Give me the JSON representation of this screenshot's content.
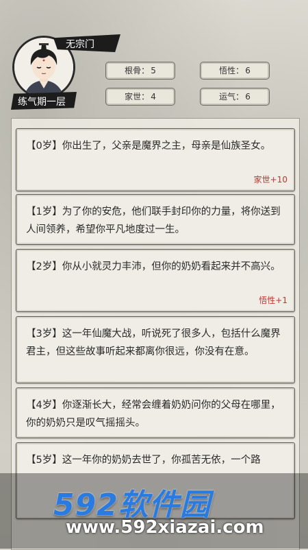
{
  "header": {
    "sect_name": "无宗门",
    "realm": "练气期一层"
  },
  "stats": [
    {
      "label": "根骨",
      "value": "5"
    },
    {
      "label": "悟性",
      "value": "6"
    },
    {
      "label": "家世",
      "value": "4"
    },
    {
      "label": "运气",
      "value": "6"
    }
  ],
  "events": [
    {
      "text": "【0岁】你出生了，父亲是魔界之主，母亲是仙族圣女。",
      "bonus": "家世+10"
    },
    {
      "text": "【1岁】为了你的安危，他们联手封印你的力量，将你送到人间领养，希望你平凡地度过一生。",
      "bonus": ""
    },
    {
      "text": "【2岁】你从小就灵力丰沛，但你的奶奶看起来并不高兴。",
      "bonus": "悟性+1"
    },
    {
      "text": "【3岁】这一年仙魔大战，听说死了很多人，包括什么魔界君主，但这些故事听起来都离你很远，你没有在意。",
      "bonus": ""
    },
    {
      "text": "【4岁】你逐渐长大，经常会缠着奶奶问你的父母在哪里，你的奶奶只是叹气摇摇头。",
      "bonus": ""
    },
    {
      "text": "【5岁】这一年你的奶奶去世了，你孤苦无依，一个路",
      "bonus": ""
    }
  ],
  "watermark": {
    "brand": "592软件园",
    "url": "www.592xiazai.com"
  },
  "icons": {
    "avatar": "cultivator-avatar-icon"
  }
}
